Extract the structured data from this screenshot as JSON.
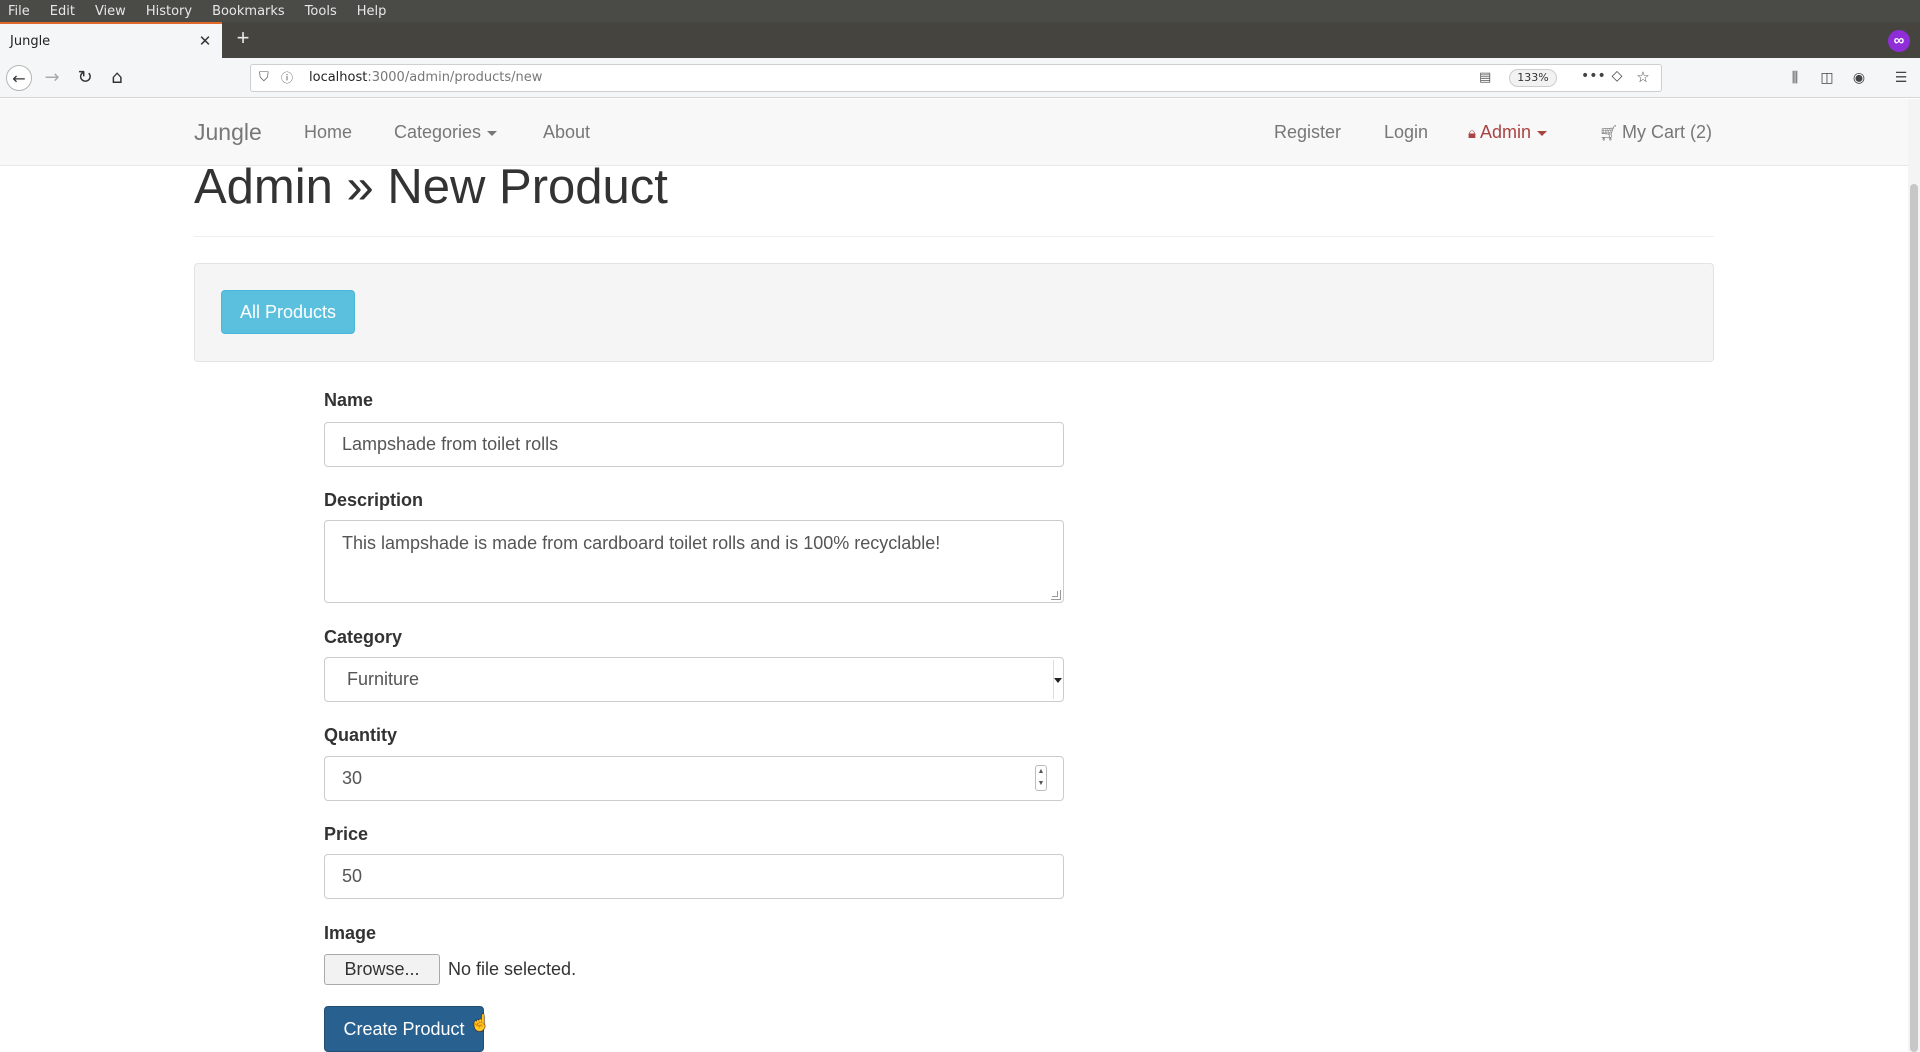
{
  "browser": {
    "menu": [
      "File",
      "Edit",
      "View",
      "History",
      "Bookmarks",
      "Tools",
      "Help"
    ],
    "tab_title": "Jungle",
    "url_host": "localhost",
    "url_path": ":3000/admin/products/new",
    "zoom": "133%"
  },
  "nav": {
    "brand": "Jungle",
    "home": "Home",
    "categories": "Categories",
    "about": "About",
    "register": "Register",
    "login": "Login",
    "admin": "Admin",
    "cart": "My Cart (2)",
    "admin_color": "#a94442"
  },
  "page": {
    "title": "Admin » New Product",
    "all_products_button": "All Products"
  },
  "form": {
    "name": {
      "label": "Name",
      "value": "Lampshade from toilet rolls"
    },
    "description": {
      "label": "Description",
      "value": "This lampshade is made from cardboard toilet rolls and is 100% recyclable!"
    },
    "category": {
      "label": "Category",
      "value": "Furniture"
    },
    "quantity": {
      "label": "Quantity",
      "value": "30"
    },
    "price": {
      "label": "Price",
      "value": "50"
    },
    "image": {
      "label": "Image",
      "browse_label": "Browse...",
      "status": "No file selected."
    },
    "submit": "Create Product"
  },
  "colors": {
    "info_button": "#5bc0de",
    "primary_button": "#286090"
  }
}
